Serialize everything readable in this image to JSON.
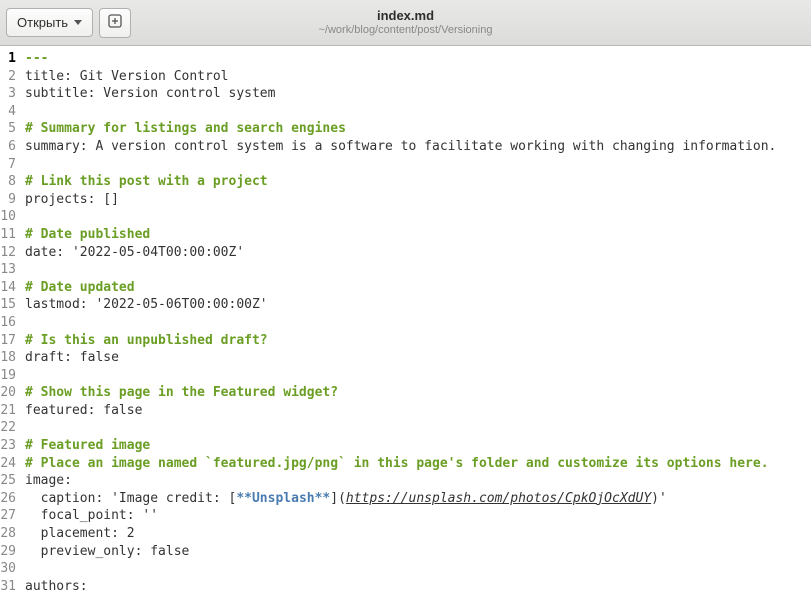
{
  "titlebar": {
    "open_label": "Открыть",
    "file_name": "index.md",
    "file_path": "~/work/blog/content/post/Versioning"
  },
  "editor": {
    "current_line": 1,
    "lines": [
      {
        "n": 1,
        "segs": [
          {
            "cls": "frontmatter",
            "t": "---"
          }
        ]
      },
      {
        "n": 2,
        "segs": [
          {
            "cls": "text",
            "t": "title: Git Version Control"
          }
        ]
      },
      {
        "n": 3,
        "segs": [
          {
            "cls": "text",
            "t": "subtitle: Version control system"
          }
        ]
      },
      {
        "n": 4,
        "segs": []
      },
      {
        "n": 5,
        "segs": [
          {
            "cls": "comment",
            "t": "# Summary for listings and search engines"
          }
        ]
      },
      {
        "n": 6,
        "segs": [
          {
            "cls": "text",
            "t": "summary: A version control system is a software to facilitate working with changing information."
          }
        ]
      },
      {
        "n": 7,
        "segs": []
      },
      {
        "n": 8,
        "segs": [
          {
            "cls": "comment",
            "t": "# Link this post with a project"
          }
        ]
      },
      {
        "n": 9,
        "segs": [
          {
            "cls": "text",
            "t": "projects: []"
          }
        ]
      },
      {
        "n": 10,
        "segs": []
      },
      {
        "n": 11,
        "segs": [
          {
            "cls": "comment",
            "t": "# Date published"
          }
        ]
      },
      {
        "n": 12,
        "segs": [
          {
            "cls": "text",
            "t": "date: '2022-05-04T00:00:00Z'"
          }
        ]
      },
      {
        "n": 13,
        "segs": []
      },
      {
        "n": 14,
        "segs": [
          {
            "cls": "comment",
            "t": "# Date updated"
          }
        ]
      },
      {
        "n": 15,
        "segs": [
          {
            "cls": "text",
            "t": "lastmod: '2022-05-06T00:00:00Z'"
          }
        ]
      },
      {
        "n": 16,
        "segs": []
      },
      {
        "n": 17,
        "segs": [
          {
            "cls": "comment",
            "t": "# Is this an unpublished draft?"
          }
        ]
      },
      {
        "n": 18,
        "segs": [
          {
            "cls": "text",
            "t": "draft: false"
          }
        ]
      },
      {
        "n": 19,
        "segs": []
      },
      {
        "n": 20,
        "segs": [
          {
            "cls": "comment",
            "t": "# Show this page in the Featured widget?"
          }
        ]
      },
      {
        "n": 21,
        "segs": [
          {
            "cls": "text",
            "t": "featured: false"
          }
        ]
      },
      {
        "n": 22,
        "segs": []
      },
      {
        "n": 23,
        "segs": [
          {
            "cls": "comment",
            "t": "# Featured image"
          }
        ]
      },
      {
        "n": 24,
        "segs": [
          {
            "cls": "comment",
            "t": "# Place an image named `featured.jpg/png` in this page's folder and customize its options here."
          }
        ]
      },
      {
        "n": 25,
        "segs": [
          {
            "cls": "text",
            "t": "image:"
          }
        ]
      },
      {
        "n": 26,
        "segs": [
          {
            "cls": "text",
            "t": "  caption: 'Image credit: ["
          },
          {
            "cls": "bold-md",
            "t": "**Unsplash**"
          },
          {
            "cls": "text",
            "t": "]("
          },
          {
            "cls": "link-url",
            "t": "https://unsplash.com/photos/CpkOjOcXdUY"
          },
          {
            "cls": "text",
            "t": ")'"
          }
        ]
      },
      {
        "n": 27,
        "segs": [
          {
            "cls": "text",
            "t": "  focal_point: ''"
          }
        ]
      },
      {
        "n": 28,
        "segs": [
          {
            "cls": "text",
            "t": "  placement: 2"
          }
        ]
      },
      {
        "n": 29,
        "segs": [
          {
            "cls": "text",
            "t": "  preview_only: false"
          }
        ]
      },
      {
        "n": 30,
        "segs": []
      },
      {
        "n": 31,
        "segs": [
          {
            "cls": "text",
            "t": "authors:"
          }
        ]
      }
    ]
  }
}
